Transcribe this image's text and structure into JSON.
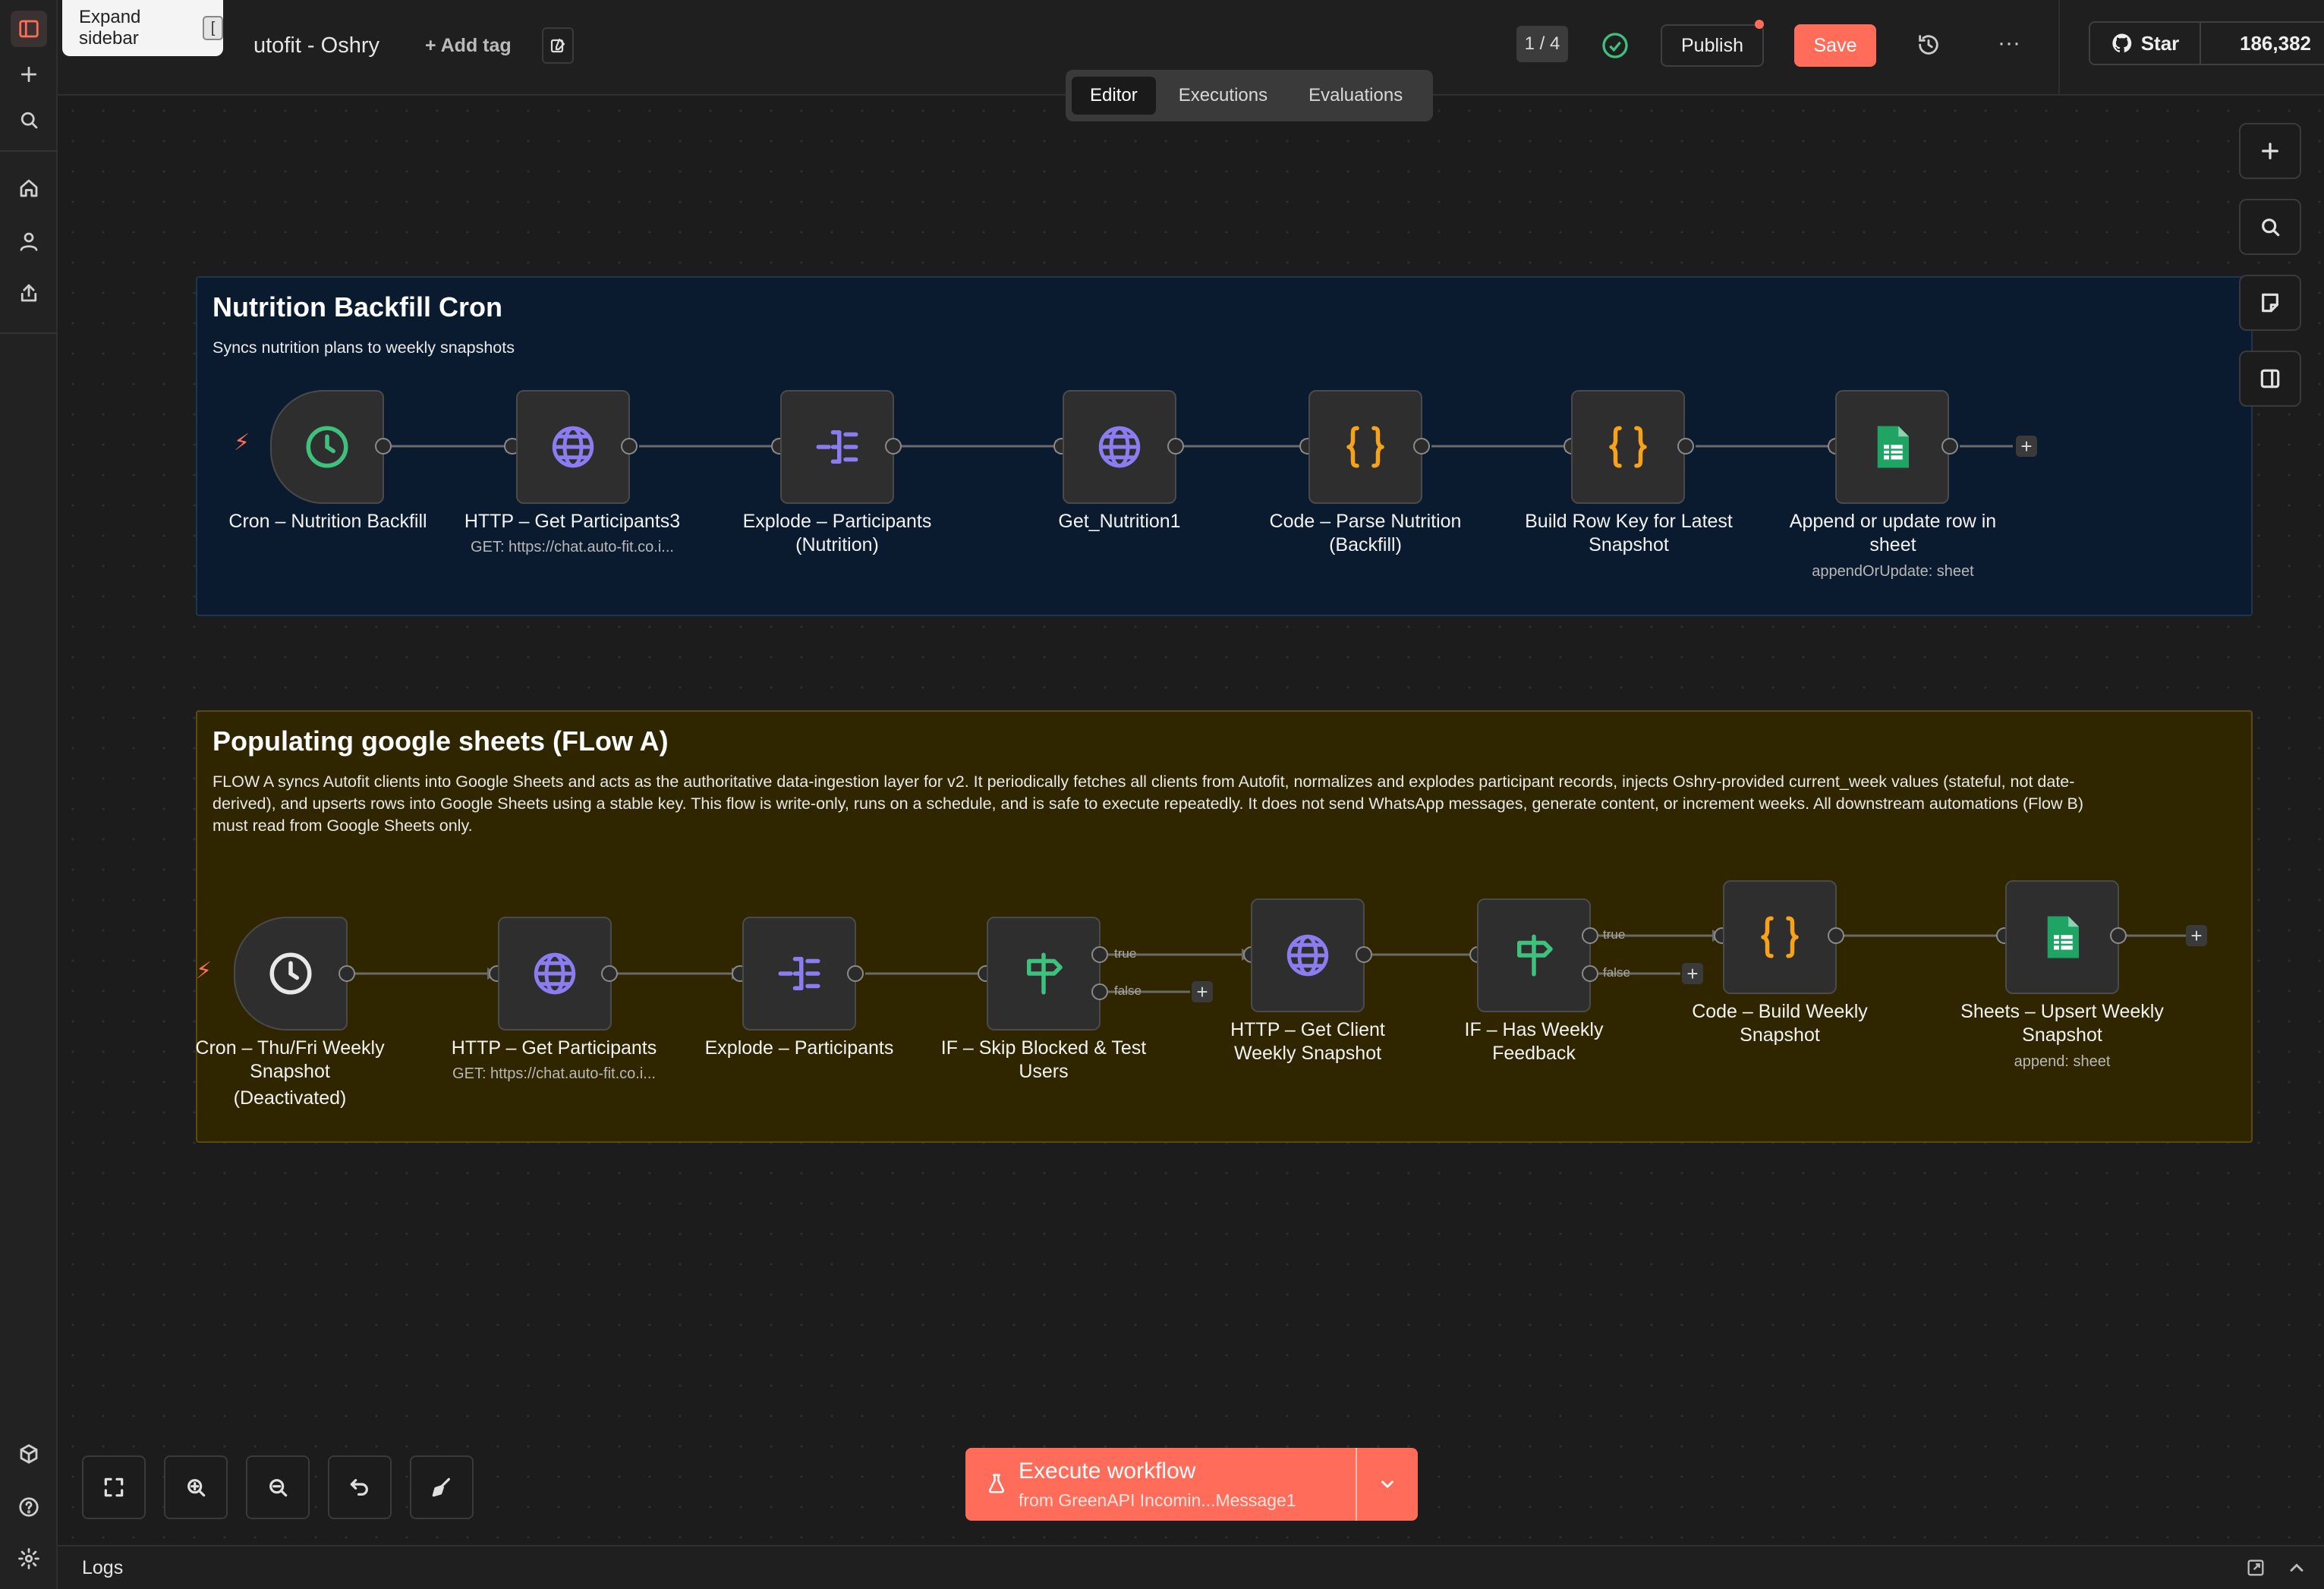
{
  "app": {
    "workflow_title": "Autofit - Oshry",
    "workflow_title_visible": "utofit - Oshry",
    "add_tag": "+ Add tag",
    "page_counter": "1 / 4",
    "publish_label": "Publish",
    "save_label": "Save",
    "github_star_label": "Star",
    "github_star_count": "186,382",
    "accent_color": "#ff6d5a"
  },
  "tooltip": {
    "text": "Expand sidebar",
    "shortcut": "["
  },
  "tabs": [
    {
      "label": "Editor",
      "active": true
    },
    {
      "label": "Executions",
      "active": false
    },
    {
      "label": "Evaluations",
      "active": false
    }
  ],
  "sticky_notes": [
    {
      "title": "Nutrition Backfill Cron",
      "description": "Syncs nutrition plans to weekly snapshots",
      "color": "#0a1a2e"
    },
    {
      "title": "Populating google sheets (FLow A)",
      "description_lines": [
        "FLOW A syncs Autofit clients into Google Sheets and acts as the authoritative data-ingestion layer for v2. It periodically fetches all clients from Autofit, normalizes and explodes participant records, injects Oshry-provided current_week values (stateful, not date-",
        "derived), and upserts rows into Google Sheets using a stable key. This flow is write-only, runs on a schedule, and is safe to execute repeatedly. It does not send WhatsApp messages, generate content, or increment weeks. All downstream automations (Flow B)",
        "must read from Google Sheets only."
      ],
      "color": "#2e2400"
    }
  ],
  "flow1_nodes": [
    {
      "label": [
        "Cron – Nutrition Backfill"
      ],
      "icon": "clock-icon",
      "sub": ""
    },
    {
      "label": [
        "HTTP – Get Participants3"
      ],
      "icon": "globe-icon",
      "sub": "GET: https://chat.auto-fit.co.i..."
    },
    {
      "label": [
        "Explode – Participants",
        "(Nutrition)"
      ],
      "icon": "split-icon",
      "sub": ""
    },
    {
      "label": [
        "Get_Nutrition1"
      ],
      "icon": "globe-icon",
      "sub": ""
    },
    {
      "label": [
        "Code – Parse Nutrition",
        "(Backfill)"
      ],
      "icon": "code-icon",
      "sub": ""
    },
    {
      "label": [
        "Build Row Key for Latest",
        "Snapshot"
      ],
      "icon": "code-icon",
      "sub": ""
    },
    {
      "label": [
        "Append or update row in",
        "sheet"
      ],
      "icon": "sheets-icon",
      "sub": "appendOrUpdate: sheet"
    }
  ],
  "flow2_nodes": [
    {
      "label": [
        "Cron – Thu/Fri Weekly",
        "Snapshot",
        "(Deactivated)"
      ],
      "icon": "clock-icon",
      "sub": ""
    },
    {
      "label": [
        "HTTP – Get Participants"
      ],
      "icon": "globe-icon",
      "sub": "GET: https://chat.auto-fit.co.i..."
    },
    {
      "label": [
        "Explode – Participants"
      ],
      "icon": "split-icon",
      "sub": ""
    },
    {
      "label": [
        "IF – Skip Blocked & Test",
        "Users"
      ],
      "icon": "signpost-icon",
      "sub": ""
    },
    {
      "label": [
        "HTTP – Get Client",
        "Weekly Snapshot"
      ],
      "icon": "globe-icon",
      "sub": ""
    },
    {
      "label": [
        "IF – Has Weekly",
        "Feedback"
      ],
      "icon": "signpost-icon",
      "sub": ""
    },
    {
      "label": [
        "Code – Build Weekly",
        "Snapshot"
      ],
      "icon": "code-icon",
      "sub": ""
    },
    {
      "label": [
        "Sheets – Upsert Weekly",
        "Snapshot"
      ],
      "icon": "sheets-icon",
      "sub": "append: sheet"
    }
  ],
  "branch_labels": {
    "true": "true",
    "false": "false"
  },
  "execute": {
    "label": "Execute workflow",
    "sub": "from GreenAPI Incomin...Message1"
  },
  "logs": {
    "label": "Logs"
  }
}
